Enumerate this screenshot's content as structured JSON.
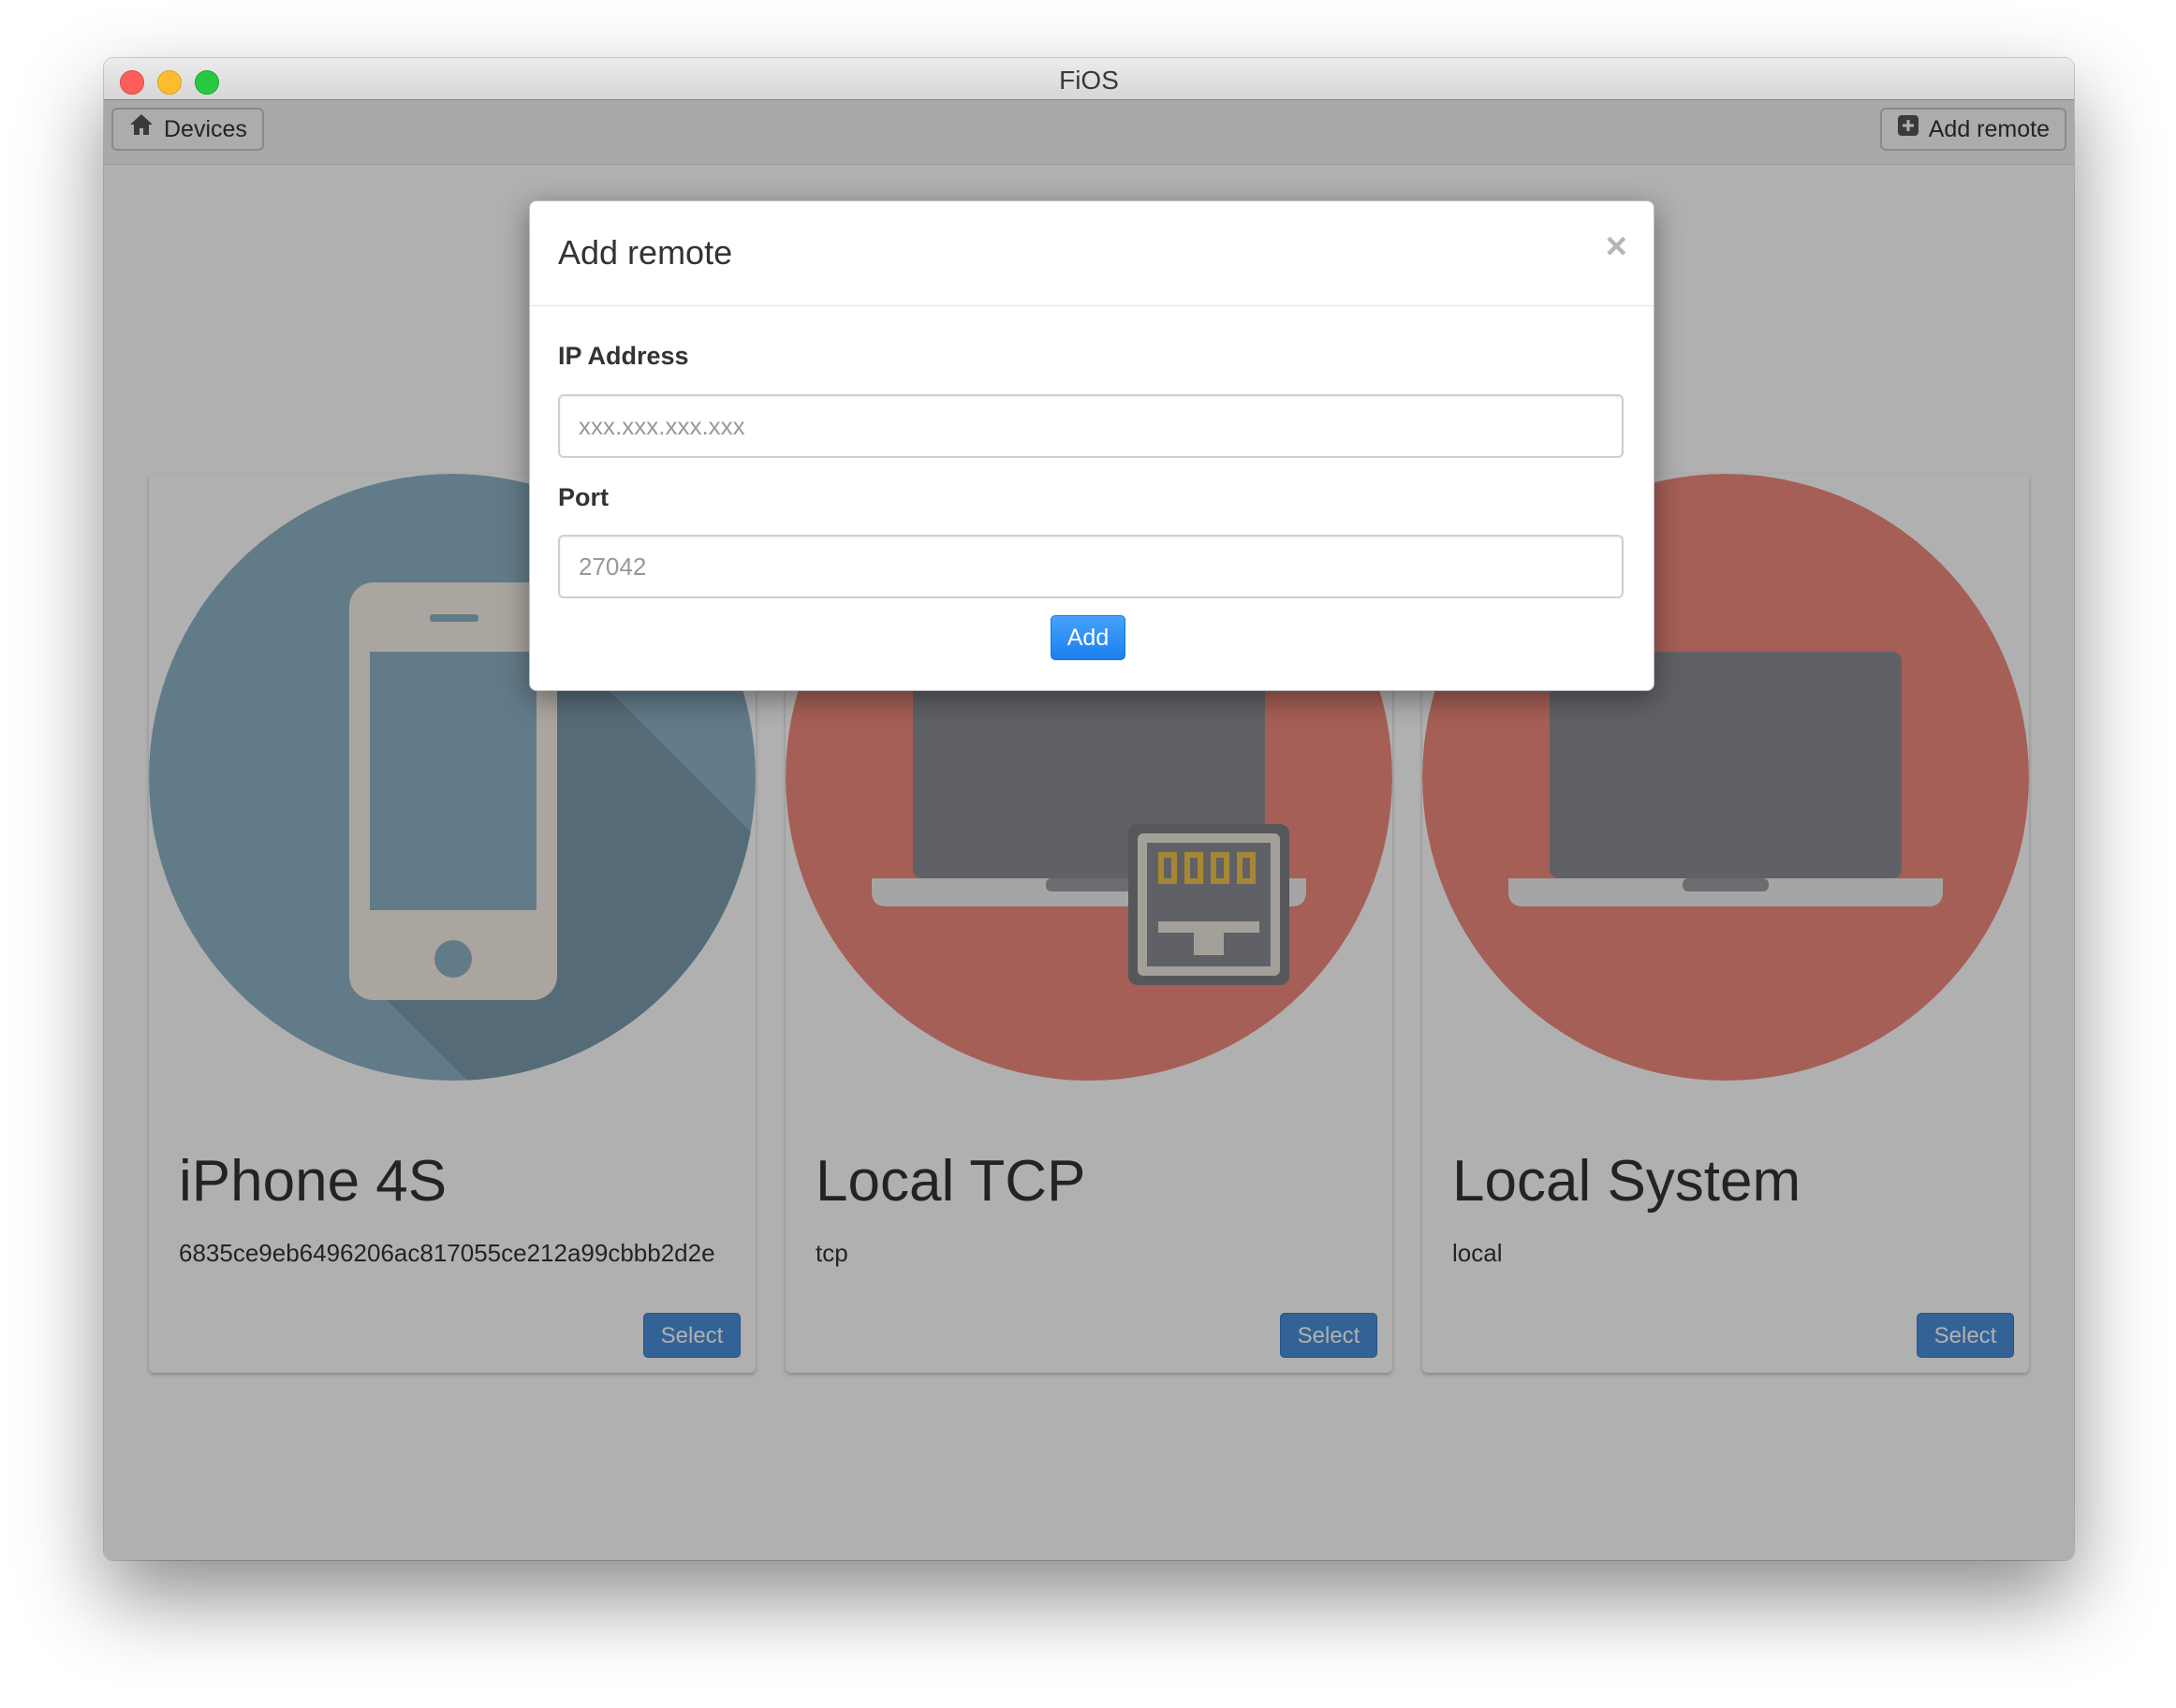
{
  "window": {
    "title": "FiOS"
  },
  "toolbar": {
    "devices_label": "Devices",
    "devices_icon": "home-icon",
    "add_remote_label": "Add remote",
    "add_remote_icon": "plus-square-icon"
  },
  "devices": [
    {
      "name": "iPhone 4S",
      "id": "6835ce9eb6496206ac817055ce212a99cbbb2d2e",
      "select_label": "Select",
      "icon": "phone-icon",
      "color": "#8fb3c6"
    },
    {
      "name": "Local TCP",
      "id": "tcp",
      "select_label": "Select",
      "icon": "laptop-ethernet-icon",
      "color": "#ef8a7e"
    },
    {
      "name": "Local System",
      "id": "local",
      "select_label": "Select",
      "icon": "laptop-icon",
      "color": "#ef8a7e"
    }
  ],
  "modal": {
    "title": "Add remote",
    "close_symbol": "×",
    "ip_label": "IP Address",
    "ip_placeholder": "xxx.xxx.xxx.xxx",
    "ip_value": "",
    "port_label": "Port",
    "port_placeholder": "27042",
    "port_value": "",
    "add_label": "Add"
  },
  "colors": {
    "primary": "#1b7ff0",
    "select_button": "#4a90d9"
  }
}
